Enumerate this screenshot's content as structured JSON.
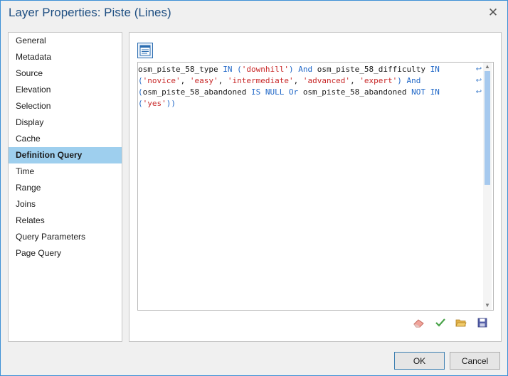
{
  "window": {
    "title": "Layer Properties: Piste (Lines)",
    "close_glyph": "✕",
    "accent_color": "#1f4f82",
    "selected_color": "#9ecfee"
  },
  "nav": {
    "items": [
      {
        "label": "General"
      },
      {
        "label": "Metadata"
      },
      {
        "label": "Source"
      },
      {
        "label": "Elevation"
      },
      {
        "label": "Selection"
      },
      {
        "label": "Display"
      },
      {
        "label": "Cache"
      },
      {
        "label": "Definition Query",
        "selected": true
      },
      {
        "label": "Time"
      },
      {
        "label": "Range"
      },
      {
        "label": "Joins"
      },
      {
        "label": "Relates"
      },
      {
        "label": "Query Parameters"
      },
      {
        "label": "Page Query"
      }
    ]
  },
  "editor": {
    "mode_icon": "sql-mode-icon",
    "lines": [
      [
        {
          "t": "id",
          "v": "osm_piste_58_type "
        },
        {
          "t": "kw",
          "v": "IN ("
        },
        {
          "t": "str",
          "v": "'downhill'"
        },
        {
          "t": "kw",
          "v": ") And "
        },
        {
          "t": "id",
          "v": "osm_piste_58_difficulty "
        },
        {
          "t": "kw",
          "v": "IN"
        }
      ],
      [
        {
          "t": "kw",
          "v": "("
        },
        {
          "t": "str",
          "v": "'novice'"
        },
        {
          "t": "id",
          "v": ", "
        },
        {
          "t": "str",
          "v": "'easy'"
        },
        {
          "t": "id",
          "v": ", "
        },
        {
          "t": "str",
          "v": "'intermediate'"
        },
        {
          "t": "id",
          "v": ", "
        },
        {
          "t": "str",
          "v": "'advanced'"
        },
        {
          "t": "id",
          "v": ", "
        },
        {
          "t": "str",
          "v": "'expert'"
        },
        {
          "t": "kw",
          "v": ") And"
        }
      ],
      [
        {
          "t": "kw",
          "v": "("
        },
        {
          "t": "id",
          "v": "osm_piste_58_abandoned "
        },
        {
          "t": "kw",
          "v": "IS NULL Or "
        },
        {
          "t": "id",
          "v": "osm_piste_58_abandoned "
        },
        {
          "t": "kw",
          "v": "NOT IN"
        }
      ],
      [
        {
          "t": "kw",
          "v": "("
        },
        {
          "t": "str",
          "v": "'yes'"
        },
        {
          "t": "kw",
          "v": "))"
        }
      ]
    ],
    "wrap_glyph": "↩",
    "wrapped_line_count": 3,
    "scroll_up_glyph": "▲",
    "scroll_down_glyph": "▼"
  },
  "toolbar": {
    "tools": [
      "eraser-icon",
      "check-icon",
      "open-folder-icon",
      "save-icon"
    ]
  },
  "buttons": {
    "ok_label": "OK",
    "cancel_label": "Cancel"
  }
}
